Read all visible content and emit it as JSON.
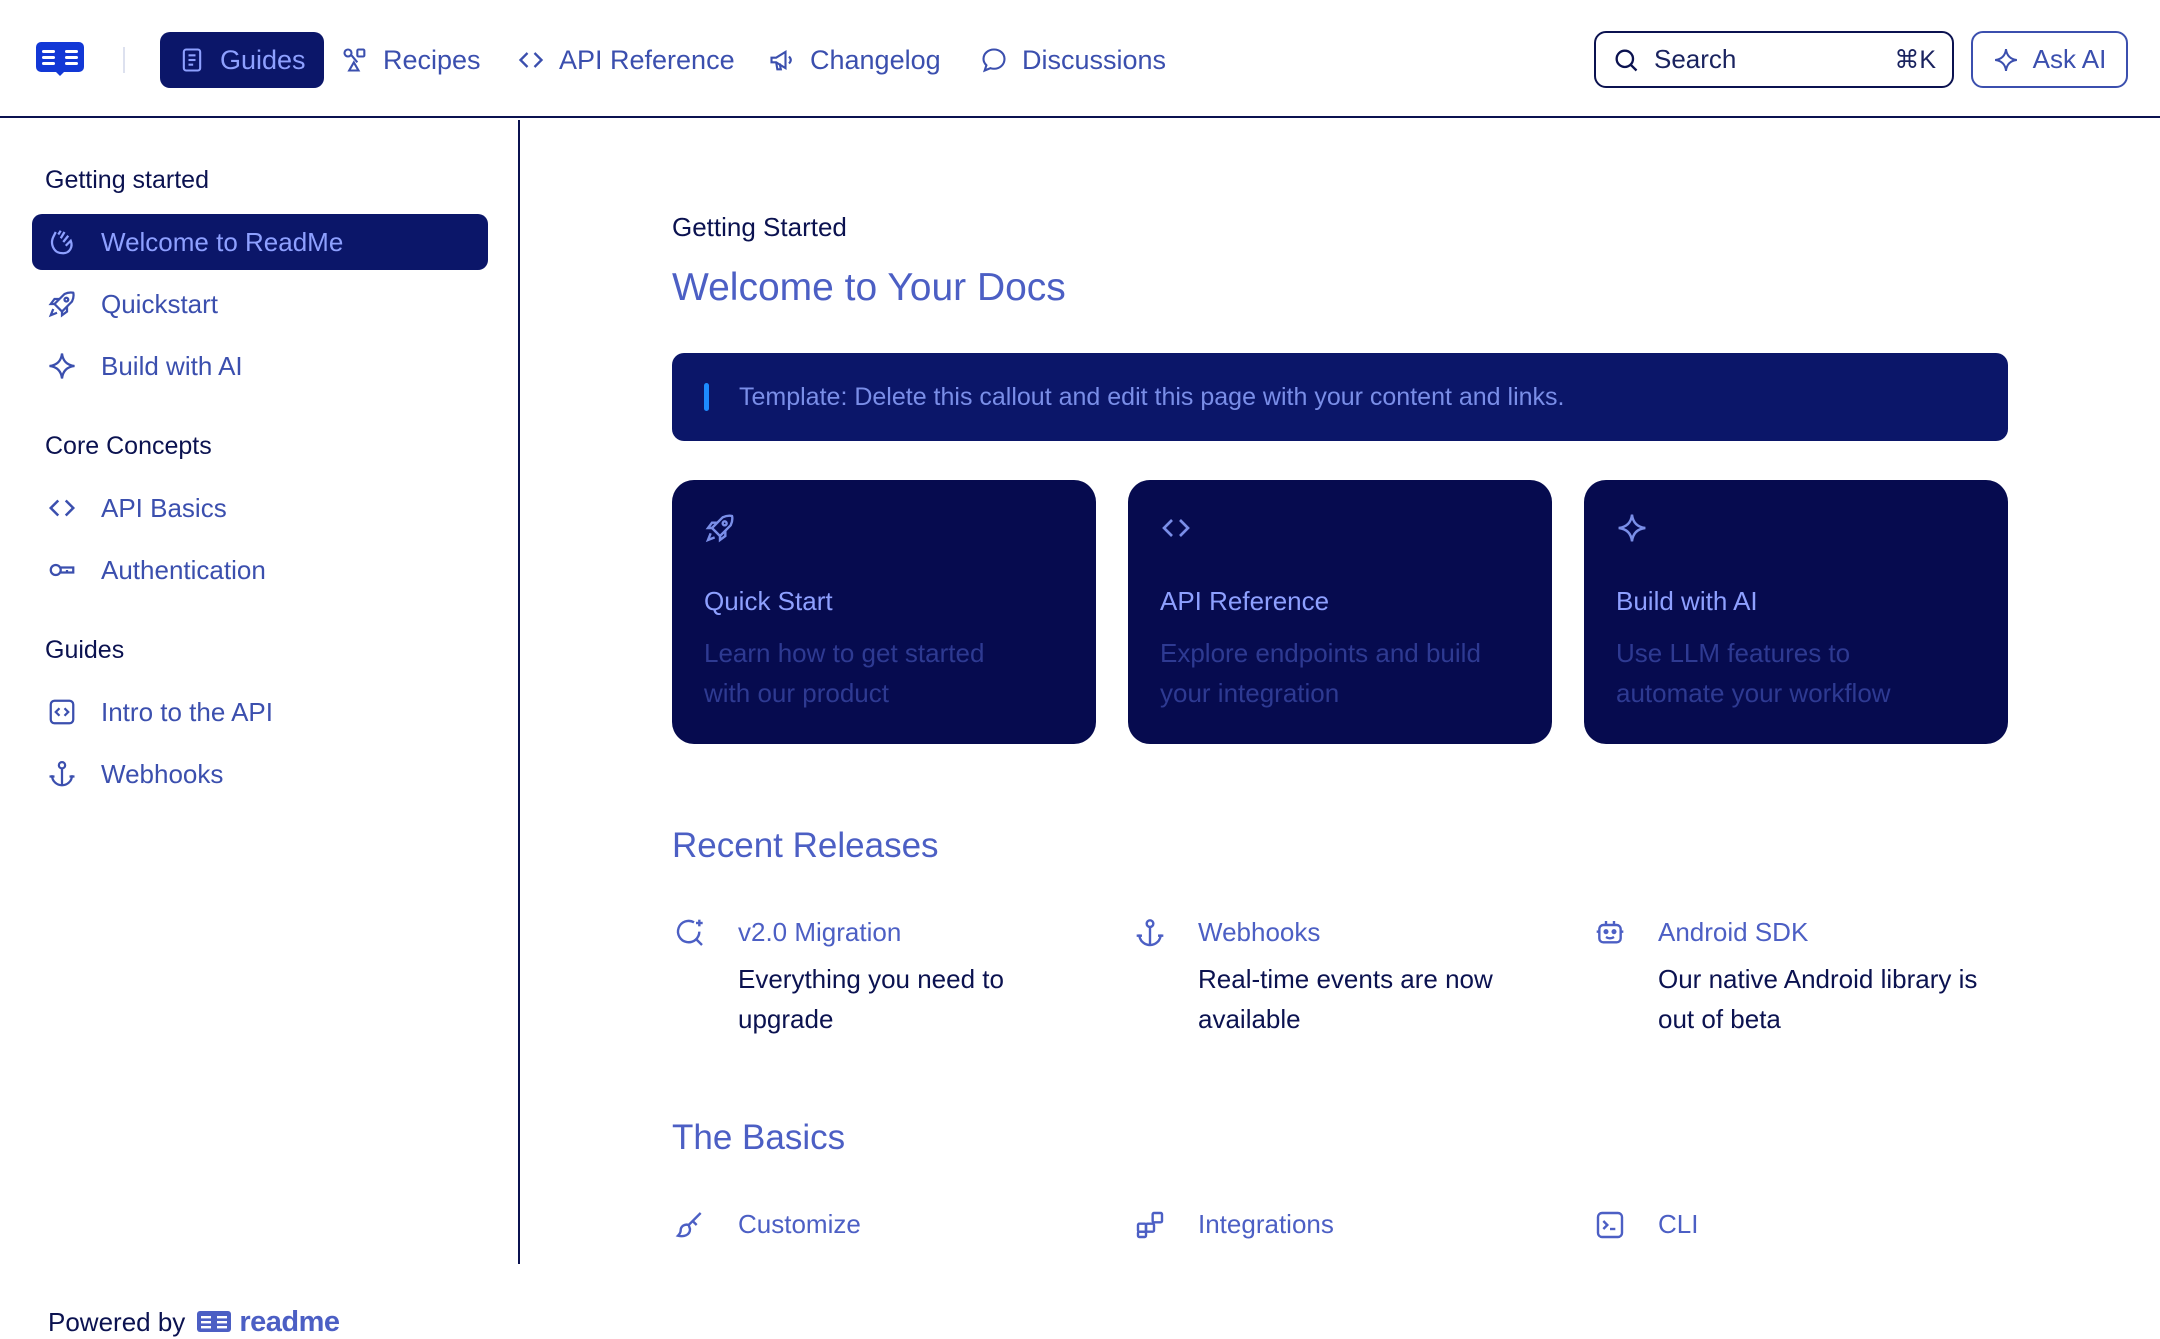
{
  "topnav": {
    "items": [
      {
        "label": "Guides",
        "icon": "book-icon",
        "active": true
      },
      {
        "label": "Recipes",
        "icon": "recipes-icon"
      },
      {
        "label": "API Reference",
        "icon": "code-icon"
      },
      {
        "label": "Changelog",
        "icon": "megaphone-icon"
      },
      {
        "label": "Discussions",
        "icon": "chat-bubble-icon"
      }
    ],
    "search": {
      "label": "Search",
      "shortcut": "⌘K"
    },
    "ask_ai": "Ask AI"
  },
  "sidebar": {
    "sections": [
      {
        "heading": "Getting started",
        "items": [
          {
            "label": "Welcome to ReadMe",
            "icon": "wave-hand-icon",
            "active": true
          },
          {
            "label": "Quickstart",
            "icon": "rocket-icon"
          },
          {
            "label": "Build with AI",
            "icon": "sparkle-icon"
          }
        ]
      },
      {
        "heading": "Core Concepts",
        "items": [
          {
            "label": "API Basics",
            "icon": "code-icon"
          },
          {
            "label": "Authentication",
            "icon": "key-icon"
          }
        ]
      },
      {
        "heading": "Guides",
        "items": [
          {
            "label": "Intro to the API",
            "icon": "code-square-icon"
          },
          {
            "label": "Webhooks",
            "icon": "anchor-icon"
          }
        ]
      }
    ],
    "powered_by": "Powered by",
    "brand": "readme"
  },
  "main": {
    "eyebrow": "Getting Started",
    "title": "Welcome to Your Docs",
    "callout": "Template: Delete this callout and edit this page with your content and links.",
    "cards": [
      {
        "title": "Quick Start",
        "desc": "Learn how to get started with our product",
        "icon": "rocket-icon"
      },
      {
        "title": "API Reference",
        "desc": "Explore endpoints and build your integration",
        "icon": "code-icon"
      },
      {
        "title": "Build with AI",
        "desc": "Use LLM features to automate your workflow",
        "icon": "sparkle-icon"
      }
    ],
    "recent_releases": {
      "title": "Recent Releases",
      "items": [
        {
          "title": "v2.0 Migration",
          "desc": "Everything you need to upgrade",
          "icon": "search-sparkle-icon"
        },
        {
          "title": "Webhooks",
          "desc": "Real-time events are now available",
          "icon": "anchor-icon"
        },
        {
          "title": "Android SDK",
          "desc": "Our native Android library is out of beta",
          "icon": "robot-icon"
        }
      ]
    },
    "basics": {
      "title": "The Basics",
      "items": [
        {
          "title": "Customize",
          "icon": "brush-icon"
        },
        {
          "title": "Integrations",
          "icon": "blocks-icon"
        },
        {
          "title": "CLI",
          "icon": "terminal-icon"
        }
      ]
    }
  },
  "colors": {
    "accent": "#4c5fc4",
    "navy": "#0b1669",
    "card_bg": "#060b4f",
    "callout_bar": "#1d8bff"
  }
}
